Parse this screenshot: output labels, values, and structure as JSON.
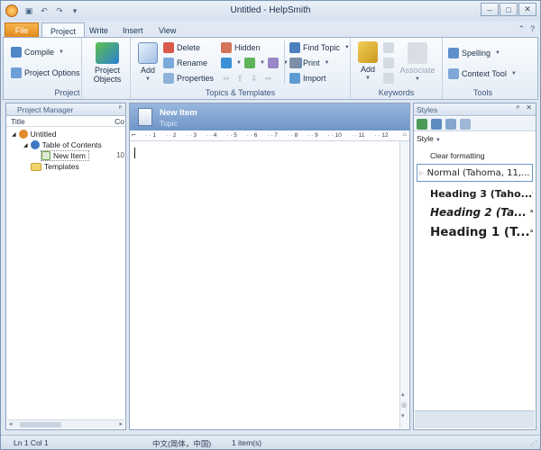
{
  "window": {
    "title": "Untitled - HelpSmith"
  },
  "tabs": {
    "file": "File",
    "project": "Project",
    "write": "Write",
    "insert": "Insert",
    "view": "View"
  },
  "ribbon": {
    "compile": "Compile",
    "project_options": "Project Options",
    "project_objects": "Project Objects",
    "project_group": "Project",
    "add": "Add",
    "delete": "Delete",
    "rename": "Rename",
    "properties": "Properties",
    "hidden": "Hidden",
    "find_topic": "Find Topic",
    "print": "Print",
    "import": "Import",
    "topics_group": "Topics & Templates",
    "kw_add": "Add",
    "associate": "Associate",
    "keywords_group": "Keywords",
    "spelling": "Spelling",
    "context_tool": "Context Tool",
    "tools_group": "Tools"
  },
  "project_manager": {
    "title": "Project Manager",
    "col_title": "Title",
    "col_co": "Co",
    "items": [
      {
        "label": "Untitled"
      },
      {
        "label": "Table of Contents"
      },
      {
        "label": "New Item",
        "extra": "10"
      },
      {
        "label": "Templates"
      }
    ]
  },
  "editor": {
    "topic_title": "New Item",
    "topic_kind": "Topic",
    "ruler_marks": [
      "1",
      "2",
      "3",
      "4",
      "5",
      "6",
      "7",
      "8",
      "9",
      "10",
      "11",
      "12"
    ]
  },
  "styles_panel": {
    "title": "Styles",
    "style_dropdown": "Style",
    "items": [
      {
        "label": "Clear formatting"
      },
      {
        "label": "Normal (Tahoma, 11,..."
      },
      {
        "label": "Heading 3 (Taho..."
      },
      {
        "label": "Heading 2 (Ta..."
      },
      {
        "label": "Heading 1 (T..."
      }
    ]
  },
  "status": {
    "position": "Ln 1 Col 1",
    "language": "中文(简体，中国)",
    "items": "1 item(s)"
  }
}
